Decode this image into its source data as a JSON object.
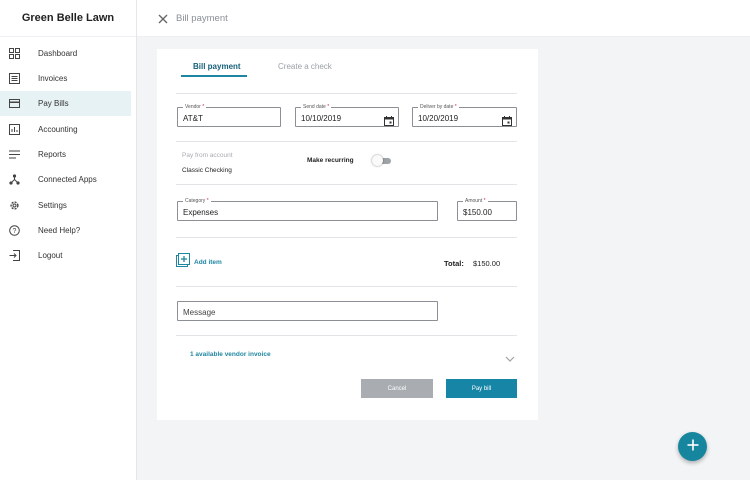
{
  "app": {
    "name": "Green Belle Lawn",
    "page_title": "Bill payment"
  },
  "sidebar": {
    "items": [
      {
        "label": "Dashboard",
        "icon": "dashboard-icon"
      },
      {
        "label": "Invoices",
        "icon": "invoices-icon"
      },
      {
        "label": "Pay Bills",
        "icon": "credit-card-icon",
        "active": true
      },
      {
        "label": "Accounting",
        "icon": "chart-icon"
      },
      {
        "label": "Reports",
        "icon": "reports-icon"
      },
      {
        "label": "Connected Apps",
        "icon": "connected-apps-icon"
      },
      {
        "label": "Settings",
        "icon": "gear-icon"
      },
      {
        "label": "Need Help?",
        "icon": "help-icon"
      },
      {
        "label": "Logout",
        "icon": "logout-icon"
      }
    ]
  },
  "tabs": [
    {
      "label": "Bill payment",
      "active": true
    },
    {
      "label": "Create a check",
      "active": false
    }
  ],
  "form": {
    "vendor": {
      "label": "Vendor",
      "value": "AT&T",
      "required": true
    },
    "send_date": {
      "label": "Send date",
      "value": "10/10/2019",
      "required": true
    },
    "deliver_by_date": {
      "label": "Deliver by date",
      "value": "10/20/2019",
      "required": true
    },
    "pay_from_account": {
      "label": "Pay from account",
      "value": "Classic Checking"
    },
    "make_recurring": {
      "label": "Make recurring",
      "enabled": false
    },
    "category": {
      "label": "Category",
      "value": "Expenses",
      "required": true
    },
    "amount": {
      "label": "Amount",
      "value": "$150.00",
      "required": true
    },
    "add_item_label": "Add item",
    "total_label": "Total:",
    "total_value": "$150.00",
    "message": {
      "placeholder": "Message"
    },
    "vendor_invoice_link": "1 available vendor invoice"
  },
  "actions": {
    "cancel": "Cancel",
    "pay": "Pay bill"
  },
  "colors": {
    "accent": "#1786a6",
    "active_nav_bg": "#e7f2f5",
    "required": "#c5283d",
    "cancel_button": "#a9adb1"
  }
}
